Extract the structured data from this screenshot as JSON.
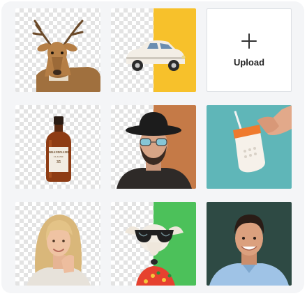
{
  "upload": {
    "label": "Upload",
    "icon": "plus-icon"
  },
  "tiles": [
    {
      "subject": "deer",
      "background": "transparent"
    },
    {
      "subject": "vintage-car",
      "background": "split",
      "accent": "#f7c12b"
    },
    {
      "subject": "upload"
    },
    {
      "subject": "amber-bottle",
      "background": "transparent"
    },
    {
      "subject": "man-with-hat",
      "background": "split",
      "accent": "#c57a47"
    },
    {
      "subject": "hand-with-cup",
      "background": "teal",
      "accent": "#5fb6b8"
    },
    {
      "subject": "blonde-woman",
      "background": "transparent"
    },
    {
      "subject": "dog-with-sunglasses",
      "background": "split",
      "accent": "#4cc15a"
    },
    {
      "subject": "smiling-man",
      "background": "dark",
      "accent": "#2e4a44"
    }
  ],
  "bottle_label": {
    "brand": "BRANDNAME",
    "line2": "CLASSIC",
    "number": "35"
  }
}
